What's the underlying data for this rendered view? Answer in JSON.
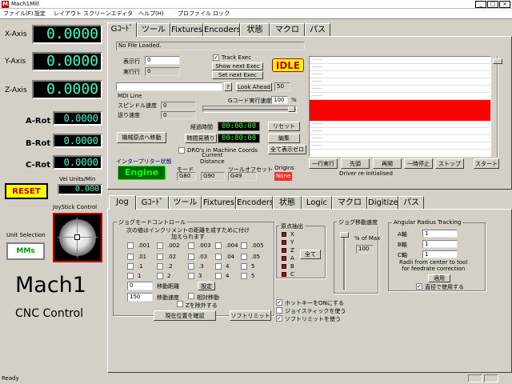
{
  "window": {
    "icon": "M",
    "title": "Mach1Mill",
    "min": "_",
    "max": "□",
    "close": "×"
  },
  "menu": [
    "ファイル(F)",
    "設定",
    "レイアウト",
    "スクリーンエディタ",
    "ヘルプ(H)",
    "プロファイル",
    "ロック"
  ],
  "axes": [
    {
      "label": "X-Axis",
      "value": "0.0000"
    },
    {
      "label": "Y-Axis",
      "value": "0.0000"
    },
    {
      "label": "Z-Axis",
      "value": "0.0000"
    },
    {
      "label": "A-Rot",
      "value": "0.0000"
    },
    {
      "label": "B-Rot",
      "value": "0.0000"
    },
    {
      "label": "C-Rot",
      "value": "0.0000"
    }
  ],
  "vel": {
    "label": "Vel Units/Min",
    "value": "0.000"
  },
  "reset_label": "RESET",
  "joystick_label": "JoyStick Control",
  "unit": {
    "label": "Unit Selection",
    "value": "MMs"
  },
  "brand": {
    "name": "Mach1",
    "subtitle": "CNC Control"
  },
  "top_tabs": [
    "Gｺｰﾄﾞ",
    "ツール",
    "Fixtures",
    "Encoders",
    "状態",
    "マクロ",
    "パス"
  ],
  "gcode": {
    "file": "No File Loaded.",
    "display_line_label": "表示行",
    "display_line": "0",
    "exec_line_label": "実行行",
    "exec_line": "0",
    "track_exec": "Track Exec",
    "show_next": "Show next Exec",
    "set_next": "Set next Exec",
    "idle": "IDLE",
    "question": "?",
    "lookahead": "Look Ahead",
    "lookahead_val": "50",
    "mdi_label": "MDI Line",
    "feed_rate_label": "Gコード実行速度",
    "feed_rate_val": "100",
    "feed_rate_unit": "%",
    "spindle_label": "スピンドル速度",
    "spindle_val": "0",
    "feed_label": "送り速度",
    "feed_val": "0",
    "elapsed_label": "経過時間",
    "elapsed": "00:00:00",
    "estimate_btn": "時間見積り",
    "estimate": "00:00:00",
    "reset_btn": "リセット",
    "edit_btn": "編集",
    "zero_all_btn": "全て表示ゼロ",
    "goto_origin_btn": "機械原点へ移動",
    "dro_machine": "DRO's in Machine Coords",
    "interp_label": "インタープリター状態",
    "engine": "Engine",
    "current_distance": "Current\nDistance",
    "mode_label": "モード",
    "mode_val": "G80",
    "dist_val": "G90",
    "tool_offset_label": "ツールオフセット",
    "tool_offset_val": "G49",
    "origins_label": "Origins",
    "origins_val": "None",
    "single_btn": "一行実行",
    "rewind_btn": "先頭",
    "resume_btn": "再開",
    "pause_btn": "一時停止",
    "stop_btn": "ストップ",
    "start_btn": "スタート",
    "driver_status": "Driver re-initialised"
  },
  "bottom_tabs": [
    "Jog",
    "Gｺｰﾄﾞ",
    "ツール",
    "Fixtures",
    "Encoders",
    "状態",
    "Logic",
    "マクロ",
    "Digitize",
    "パス"
  ],
  "jog": {
    "group_title": "ジョグモードコントロール",
    "desc": "次の値はインクリメントの距離を成すために付け加えられます",
    "col1": [
      ".001",
      ".01",
      ".1",
      "1"
    ],
    "col2": [
      ".002",
      ".02",
      ".2",
      "2"
    ],
    "col3": [
      ".003",
      ".03",
      ".3",
      "3"
    ],
    "col4": [
      ".004",
      ".04",
      "4",
      "4"
    ],
    "col5": [
      ".005",
      ".05",
      "5",
      "5"
    ],
    "dist_val": "0",
    "dist_label": "移動距離",
    "set_btn": "設定",
    "speed_val": "150",
    "speed_label": "移動速度",
    "relative": "相対移動",
    "exclude_z": "Zを除外する",
    "confirm_btn": "現在位置を確認",
    "softlimit_btn": "ソフトリミット"
  },
  "origin": {
    "title": "原点抽出",
    "axes": [
      "X",
      "Y",
      "Z",
      "A",
      "B",
      "C"
    ],
    "all_btn": "全て"
  },
  "jog_speed": {
    "title": "ジョグ移動速度",
    "label": "% of Max",
    "value": "100"
  },
  "hotkeys": [
    "ホットキーをONにする",
    "ジョイスティックを使う",
    "ソフトリミットを使う"
  ],
  "angular": {
    "title": "Angular Radius Tracking",
    "rows": [
      {
        "label": "A軸",
        "value": "1"
      },
      {
        "label": "B軸",
        "value": "1"
      },
      {
        "label": "C軸",
        "value": "1"
      }
    ],
    "note": "Radii from center to tool\nfor feedrate correction",
    "apply_btn": "適用",
    "use_diameter": "直径で使用する"
  },
  "status": "Ready"
}
